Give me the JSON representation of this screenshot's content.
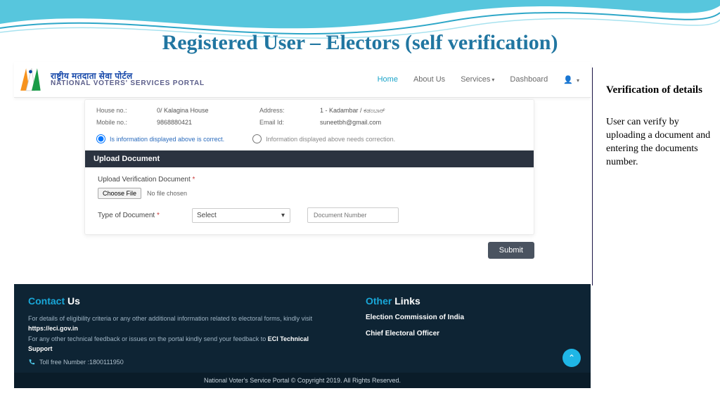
{
  "slide": {
    "title": "Registered User – Electors (self verification)"
  },
  "side": {
    "heading": "Verification of details",
    "body": " User can verify by uploading a document and entering the documents number."
  },
  "brand": {
    "hi": "राष्ट्रीय मतदाता सेवा पोर्टल",
    "en": "NATIONAL VOTERS' SERVICES PORTAL"
  },
  "nav": {
    "home": "Home",
    "about": "About Us",
    "services": "Services",
    "dashboard": "Dashboard"
  },
  "details": {
    "house_no_label": "House no.:",
    "house_no": "0/ Kalagina House",
    "address_label": "Address:",
    "address": "1 - Kadambar / ಕಡಂಬಾರ್",
    "mobile_label": "Mobile no.:",
    "mobile": "9868880421",
    "email_label": "Email Id:",
    "email": "suneetbh@gmail.com"
  },
  "radio": {
    "correct": "Is information displayed above is correct.",
    "needs": "Information displayed above needs correction."
  },
  "upload": {
    "header": "Upload Document",
    "doc_label": "Upload Verification Document",
    "choose_btn": "Choose File",
    "file_status": "No file chosen",
    "type_label": "Type of Document",
    "select_default": "Select",
    "docnum_placeholder": "Document Number",
    "submit": "Submit"
  },
  "footer": {
    "contact_h_a": "Contact",
    "contact_h_b": "Us",
    "line1_pre": "For details of eligibility criteria or any other additional information related to electoral forms, kindly visit ",
    "line1_bold": "https://eci.gov.in",
    "line2_pre": "For any other technical feedback or issues on the portal kindly send your feedback to ",
    "line2_bold": "ECI Technical Support",
    "toll": "Toll free Number :1800111950",
    "other_h_a": "Other",
    "other_h_b": "Links",
    "link1": "Election Commission of India",
    "link2": "Chief Electoral Officer",
    "bar": "National Voter's Service Portal © Copyright 2019. All Rights Reserved."
  }
}
